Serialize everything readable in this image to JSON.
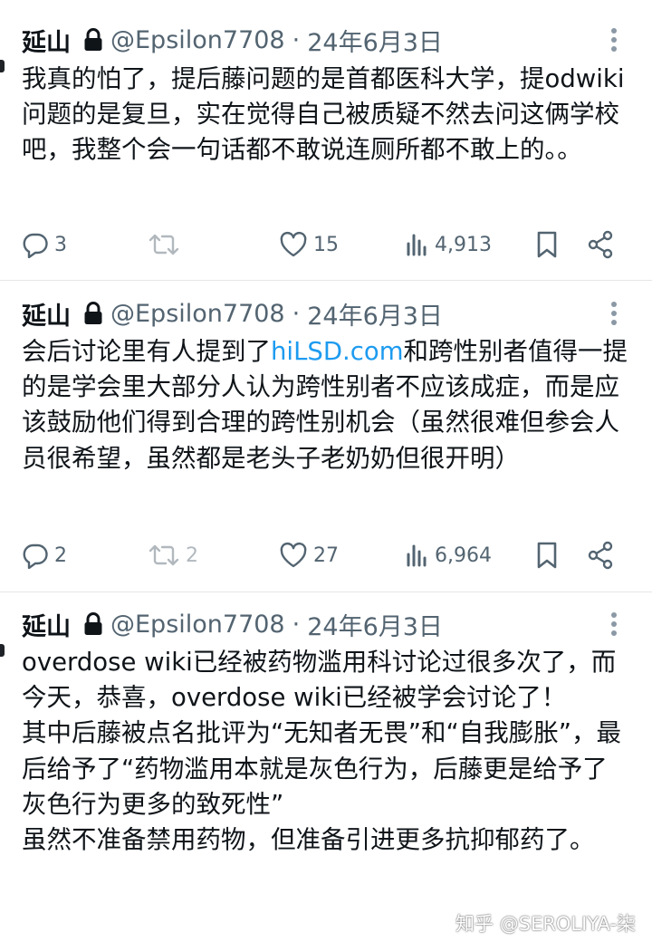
{
  "tweets": [
    {
      "name": "延山",
      "handle": "@Epsilon7708",
      "separator": "·",
      "date": "24年6月3日",
      "text": "我真的怕了，提后藤问题的是首都医科大学，提odwiki问题的是复旦，实在觉得自己被质疑不然去问这俩学校吧，我整个会一句话都不敢说连厕所都不敢上的。。",
      "replies": "3",
      "retweets": "",
      "likes": "15",
      "views": "4,913"
    },
    {
      "name": "延山",
      "handle": "@Epsilon7708",
      "separator": "·",
      "date": "24年6月3日",
      "text_before_link": "会后讨论里有人提到了",
      "link": "hiLSD.com",
      "text_after_link": "和跨性别者值得一提的是学会里大部分人认为跨性别者不应该成症，而是应该鼓励他们得到合理的跨性别机会（虽然很难但参会人员很希望，虽然都是老头子老奶奶但很开明）",
      "replies": "2",
      "retweets": "2",
      "likes": "27",
      "views": "6,964"
    },
    {
      "name": "延山",
      "handle": "@Epsilon7708",
      "separator": "·",
      "date": "24年6月3日",
      "text": "overdose wiki已经被药物滥用科讨论过很多次了，而今天，恭喜，overdose wiki已经被学会讨论了！\n其中后藤被点名批评为“无知者无畏”和“自我膨胀”，最后给予了“药物滥用本就是灰色行为，后藤更是给予了灰色行为更多的致死性”\n虽然不准备禁用药物，但准备引进更多抗抑郁药了。"
    }
  ],
  "watermark": "知乎 @SEROLIYA-柒",
  "colors": {
    "text": "#0f1419",
    "secondary": "#536471",
    "link": "#1d9bf0",
    "divider": "#e6e6e6"
  },
  "icons": [
    "lock-icon",
    "more-icon",
    "reply-icon",
    "retweet-icon",
    "like-icon",
    "views-icon",
    "bookmark-icon",
    "share-icon"
  ]
}
